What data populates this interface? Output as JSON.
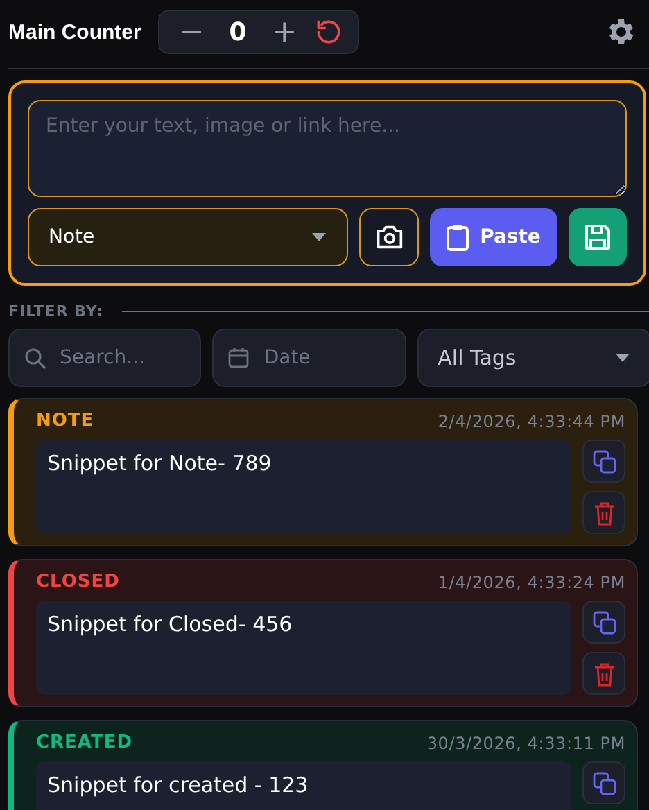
{
  "header": {
    "title": "Main Counter",
    "counter": {
      "decrement": "−",
      "value": "0",
      "increment": "+"
    }
  },
  "composer": {
    "placeholder": "Enter your text, image or link here...",
    "type_select": "Note",
    "paste_button": "Paste"
  },
  "filter": {
    "label": "FILTER BY:",
    "search_placeholder": "Search...",
    "date_placeholder": "Date",
    "tags_select": "All Tags"
  },
  "snippets": [
    {
      "tag": "NOTE",
      "color": "#f59e0b",
      "timestamp": "2/4/2026, 4:33:44 PM",
      "text": "Snippet for Note- 789",
      "actions": [
        {
          "kind": "copy"
        },
        {
          "kind": "delete"
        }
      ]
    },
    {
      "tag": "CLOSED",
      "color": "#ef4444",
      "timestamp": "1/4/2026, 4:33:24 PM",
      "text": "Snippet for Closed- 456",
      "actions": [
        {
          "kind": "copy"
        },
        {
          "kind": "delete"
        }
      ]
    },
    {
      "tag": "CREATED",
      "color": "#10b981",
      "timestamp": "30/3/2026, 4:33:11 PM",
      "text": "Snippet for created - 123",
      "actions": [
        {
          "kind": "copy"
        }
      ]
    }
  ]
}
